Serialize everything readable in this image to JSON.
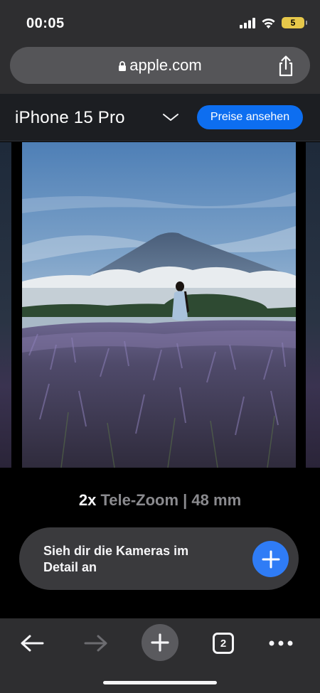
{
  "status_bar": {
    "time": "00:05",
    "battery": "5",
    "icons": [
      "signal-icon",
      "wifi-icon",
      "battery-icon"
    ]
  },
  "browser": {
    "url": "apple.com",
    "icons": [
      "lock-icon",
      "share-icon"
    ]
  },
  "product_nav": {
    "title": "iPhone 15 Pro",
    "price_button": "Preise ansehen",
    "accent_color": "#0d6ef0"
  },
  "gallery": {
    "zoom_value": "2x",
    "zoom_label": "Tele-Zoom | 48 mm"
  },
  "detail_card": {
    "text": "Sieh dir die Kameras im Detail an",
    "button_color": "#2f7cf6"
  },
  "toolbar": {
    "tab_count": "2",
    "icons": [
      "back-arrow-icon",
      "forward-arrow-icon",
      "new-tab-plus-icon",
      "tabs-icon",
      "more-icon"
    ]
  }
}
